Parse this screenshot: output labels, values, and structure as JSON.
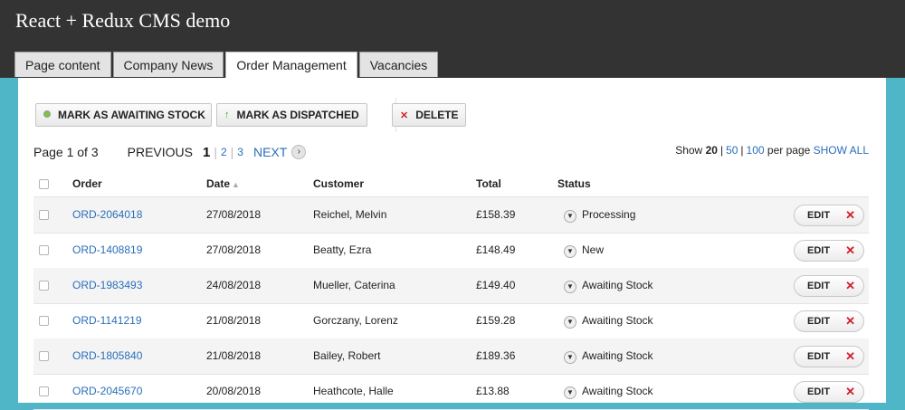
{
  "app": {
    "title": "React + Redux CMS demo"
  },
  "tabs": [
    {
      "label": "Page content"
    },
    {
      "label": "Company News"
    },
    {
      "label": "Order Management"
    },
    {
      "label": "Vacancies"
    }
  ],
  "toolbar": {
    "awaiting_stock_label": "MARK AS AWAITING STOCK",
    "dispatched_label": "MARK AS DISPATCHED",
    "delete_label": "DELETE"
  },
  "pagination": {
    "page_info": "Page 1 of 3",
    "previous_label": "PREVIOUS",
    "pages": [
      "1",
      "2",
      "3"
    ],
    "next_label": "NEXT",
    "show_label": "Show",
    "sizes": [
      "20",
      "50",
      "100"
    ],
    "per_page_label": "per page",
    "show_all_label": "SHOW ALL"
  },
  "table": {
    "columns": [
      "Order",
      "Date",
      "Customer",
      "Total",
      "Status"
    ],
    "edit_label": "EDIT",
    "rows": [
      {
        "order": "ORD-2064018",
        "date": "27/08/2018",
        "customer": "Reichel, Melvin",
        "total": "£158.39",
        "status": "Processing"
      },
      {
        "order": "ORD-1408819",
        "date": "27/08/2018",
        "customer": "Beatty, Ezra",
        "total": "£148.49",
        "status": "New"
      },
      {
        "order": "ORD-1983493",
        "date": "24/08/2018",
        "customer": "Mueller, Caterina",
        "total": "£149.40",
        "status": "Awaiting Stock"
      },
      {
        "order": "ORD-1141219",
        "date": "21/08/2018",
        "customer": "Gorczany, Lorenz",
        "total": "£159.28",
        "status": "Awaiting Stock"
      },
      {
        "order": "ORD-1805840",
        "date": "21/08/2018",
        "customer": "Bailey, Robert",
        "total": "£189.36",
        "status": "Awaiting Stock"
      },
      {
        "order": "ORD-2045670",
        "date": "20/08/2018",
        "customer": "Heathcote, Halle",
        "total": "£13.88",
        "status": "Awaiting Stock"
      }
    ]
  },
  "colors": {
    "header_bg": "#333333",
    "page_bg": "#4fb6c8",
    "link": "#2a6ebb",
    "delete_red": "#d0202a",
    "dispatch_green": "#3aa838"
  }
}
